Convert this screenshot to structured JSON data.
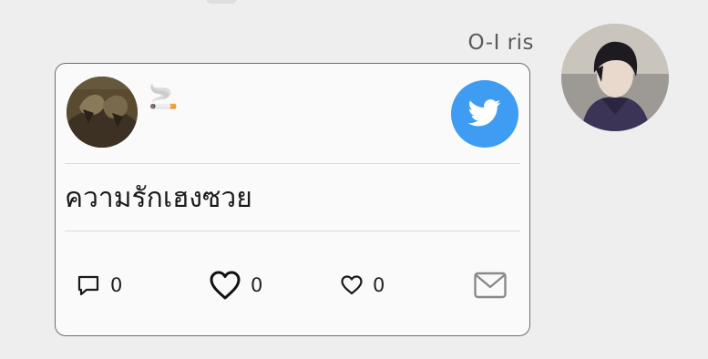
{
  "chat": {
    "sender_name": "O-I ris"
  },
  "tweet_card": {
    "poster_display": "🚬",
    "text": "ความรักเฮงซวย",
    "actions": {
      "reply_count": "0",
      "like_count": "0",
      "like2_count": "0"
    }
  },
  "icons": {
    "badge": "twitter-bird-icon",
    "reply": "speech-bubble-icon",
    "like": "heart-icon",
    "like2": "heart-icon",
    "mail": "mail-icon"
  },
  "colors": {
    "background": "#eeeeee",
    "card": "#fafafa",
    "twitter_blue": "#3f9cf3",
    "text": "#1a1a1a",
    "name_gray": "#5b5b5b",
    "mail_gray": "#8a8a8a"
  }
}
